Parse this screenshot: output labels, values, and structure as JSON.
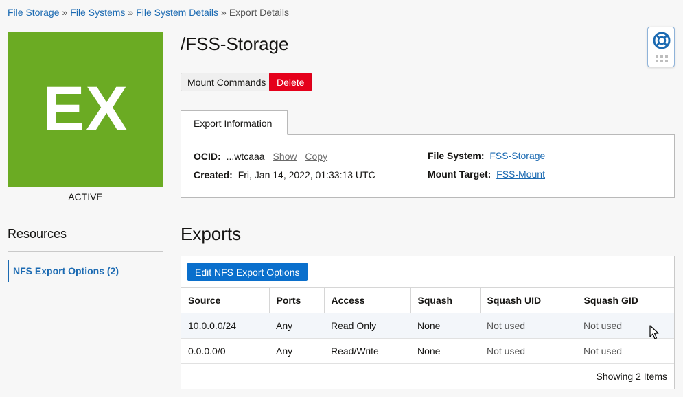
{
  "breadcrumb": {
    "items": [
      "File Storage",
      "File Systems",
      "File System Details"
    ],
    "separator": "»",
    "current": "Export Details"
  },
  "resource": {
    "tile_text": "EX",
    "tile_color": "#6bab23",
    "status": "ACTIVE",
    "title": "/FSS-Storage"
  },
  "actions": {
    "mount_commands": "Mount Commands",
    "delete": "Delete"
  },
  "export_info": {
    "tab_label": "Export Information",
    "ocid_label": "OCID:",
    "ocid_value": "...wtcaaa",
    "show": "Show",
    "copy": "Copy",
    "created_label": "Created:",
    "created_value": "Fri, Jan 14, 2022, 01:33:13 UTC",
    "file_system_label": "File System:",
    "file_system_value": "FSS-Storage",
    "mount_target_label": "Mount Target:",
    "mount_target_value": "FSS-Mount"
  },
  "resources": {
    "title": "Resources",
    "item": "NFS Export Options (2)"
  },
  "exports": {
    "title": "Exports",
    "edit_button": "Edit NFS Export Options",
    "columns": [
      "Source",
      "Ports",
      "Access",
      "Squash",
      "Squash UID",
      "Squash GID"
    ],
    "rows": [
      [
        "10.0.0.0/24",
        "Any",
        "Read Only",
        "None",
        "Not used",
        "Not used"
      ],
      [
        "0.0.0.0/0",
        "Any",
        "Read/Write",
        "None",
        "Not used",
        "Not used"
      ]
    ],
    "footer": "Showing 2 Items"
  },
  "icons": {
    "help": "lifebuoy-icon",
    "grid": "grid-dots-icon",
    "cursor": "mouse-cursor-icon"
  },
  "colors": {
    "link": "#1b6ab2",
    "primary": "#0a6fcc",
    "danger": "#e5001b"
  }
}
